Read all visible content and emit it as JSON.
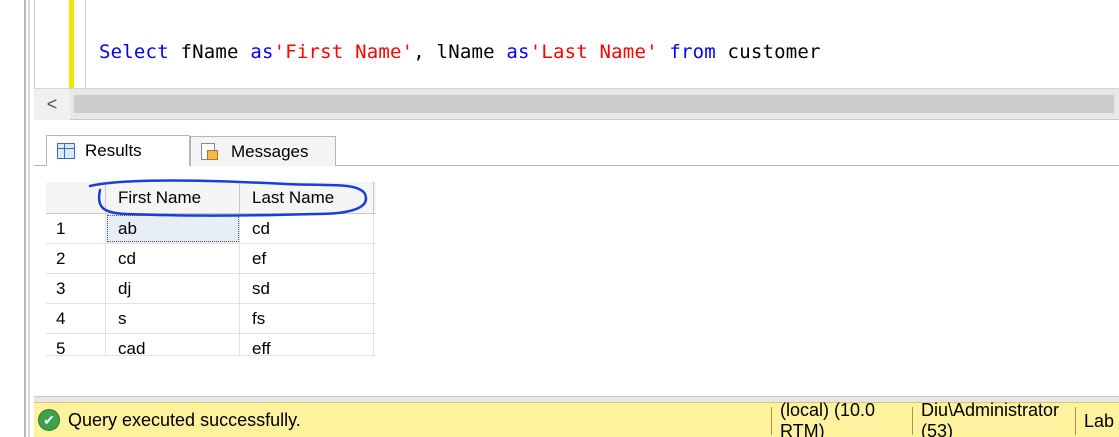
{
  "editor": {
    "query_tokens": [
      {
        "text": "Select",
        "cls": "kw"
      },
      {
        "text": " fName ",
        "cls": "plain"
      },
      {
        "text": "as",
        "cls": "kw"
      },
      {
        "text": "'First Name'",
        "cls": "str"
      },
      {
        "text": ", lName ",
        "cls": "plain"
      },
      {
        "text": "as",
        "cls": "kw"
      },
      {
        "text": "'Last Name'",
        "cls": "str"
      },
      {
        "text": " ",
        "cls": "plain"
      },
      {
        "text": "from",
        "cls": "kw"
      },
      {
        "text": " customer",
        "cls": "plain"
      }
    ]
  },
  "scrollbar": {
    "left_arrow": "<"
  },
  "tabs": {
    "results": "Results",
    "messages": "Messages"
  },
  "grid": {
    "columns": [
      "First Name",
      "Last Name"
    ],
    "rows": [
      {
        "n": "1",
        "first": "ab",
        "last": "cd"
      },
      {
        "n": "2",
        "first": "cd",
        "last": "ef"
      },
      {
        "n": "3",
        "first": "dj",
        "last": "sd"
      },
      {
        "n": "4",
        "first": "s",
        "last": "fs"
      },
      {
        "n": "5",
        "first": "cad",
        "last": "eff"
      }
    ]
  },
  "status": {
    "message": "Query executed successfully.",
    "server": "(local) (10.0 RTM)",
    "user": "Diu\\Administrator (53)",
    "database": "Lab"
  },
  "colors": {
    "keyword": "#0000ff",
    "string": "#ff0000",
    "status_bar": "#fff29e",
    "annotation": "#1a3fd6"
  }
}
